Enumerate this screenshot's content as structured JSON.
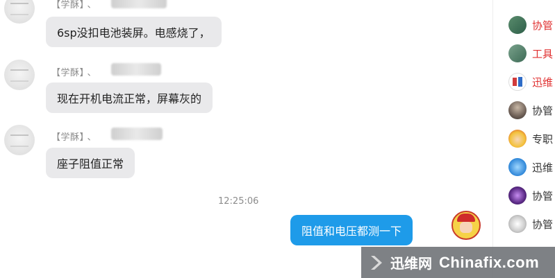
{
  "messages": [
    {
      "sender": "【学酥】",
      "separator": "、",
      "text": "6sp没扣电池装屏。电感烧了，"
    },
    {
      "sender": "【学酥】",
      "separator": "、",
      "text": "现在开机电流正常，屏幕灰的"
    },
    {
      "sender": "【学酥】",
      "separator": "、",
      "text": "座子阻值正常"
    }
  ],
  "timestamp": "12:25:06",
  "my_message": {
    "text": "阻值和电压都测一下"
  },
  "sidebar": {
    "items": [
      {
        "label": "协管",
        "color": "#e03131",
        "icon": "landscape-avatar-icon"
      },
      {
        "label": "工具",
        "color": "#e03131",
        "icon": "landscape-avatar-icon"
      },
      {
        "label": "迅维",
        "color": "#e03131",
        "icon": "chinese-text-avatar-icon"
      },
      {
        "label": "协管",
        "color": "#333333",
        "icon": "person-avatar-icon"
      },
      {
        "label": "专职",
        "color": "#333333",
        "icon": "cartoon-avatar-icon"
      },
      {
        "label": "迅维",
        "color": "#333333",
        "icon": "windows-logo-icon"
      },
      {
        "label": "协管",
        "color": "#333333",
        "icon": "purple-avatar-icon"
      },
      {
        "label": "协管",
        "color": "#333333",
        "icon": "gray-avatar-icon"
      }
    ]
  },
  "watermark": {
    "site_cn": "迅维网",
    "site_en": "Chinafix.com"
  }
}
